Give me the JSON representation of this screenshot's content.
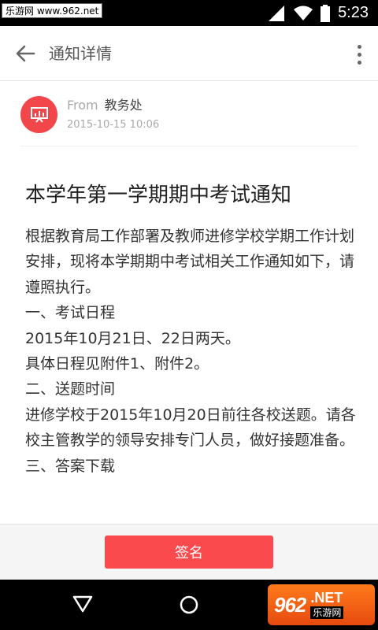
{
  "status_bar": {
    "watermark": "乐游网 www.962.net",
    "time": "5:23"
  },
  "app_bar": {
    "title": "通知详情"
  },
  "sender": {
    "from_label": "From",
    "name": "教务处",
    "date": "2015-10-15  10:06"
  },
  "notice": {
    "title": "本学年第一学期期中考试通知",
    "paragraphs": [
      "根据教育局工作部署及教师进修学校学期工作计划安排，现将本学期期中考试相关工作通知如下，请遵照执行。",
      "一、考试日程",
      "2015年10月21日、22日两天。",
      "具体日程见附件1、附件2。",
      "二、送题时间",
      "进修学校于2015年10月20日前往各校送题。请各校主管教学的领导安排专门人员，做好接题准备。",
      "三、答案下载"
    ]
  },
  "action": {
    "sign_label": "签名"
  },
  "watermark_logo": {
    "number": "962",
    "net": ".NET",
    "cn": "乐游网"
  },
  "colors": {
    "accent": "#fa4a4e",
    "avatar": "#f2474a"
  }
}
